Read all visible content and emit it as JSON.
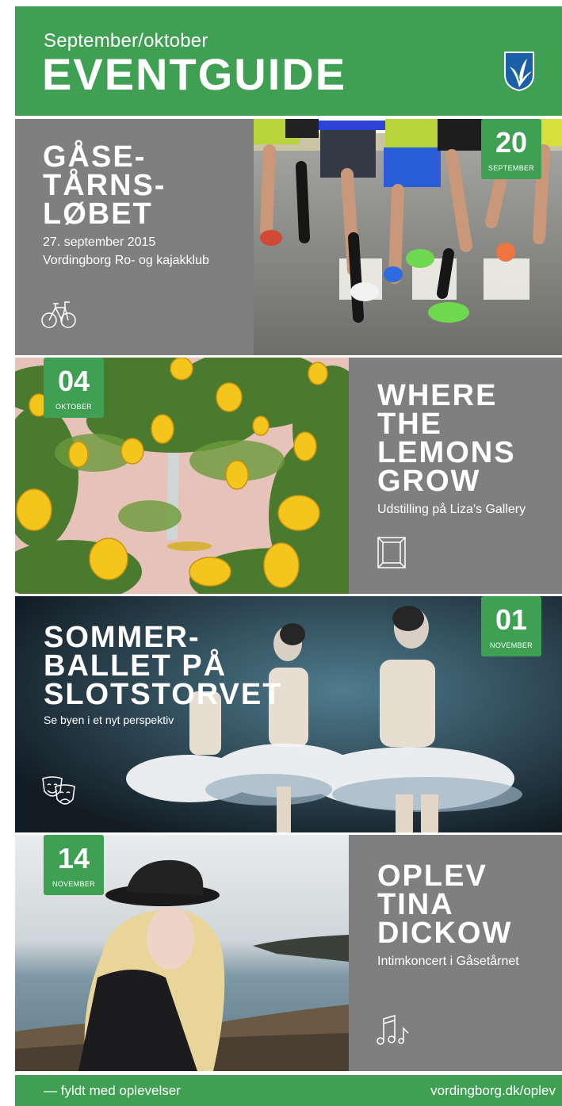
{
  "header": {
    "subtitle": "September/oktober",
    "title": "EVENTGUIDE"
  },
  "events": [
    {
      "title": "GÅSE-\nTÅRNS-\nLØBET",
      "subtitle": "27. september 2015\nVordingborg Ro- og kajakklub",
      "day": "20",
      "month": "SEPTEMBER",
      "icon": "bicycle-icon"
    },
    {
      "title": "WHERE\nTHE\nLEMONS\nGROW",
      "subtitle": "Udstilling på Liza's Gallery",
      "day": "04",
      "month": "OKTOBER",
      "icon": "picture-frame-icon"
    },
    {
      "title": "SOMMER-\nBALLET PÅ\nSLOTSTORVET",
      "subtitle": "Se byen i et nyt perspektiv",
      "day": "01",
      "month": "NOVEMBER",
      "icon": "theater-masks-icon"
    },
    {
      "title": "OPLEV\nTINA\nDICKOW",
      "subtitle": "Intimkoncert i Gåsetårnet",
      "day": "14",
      "month": "NOVEMBER",
      "icon": "music-notes-icon"
    }
  ],
  "footer": {
    "tagline": "— fyldt med oplevelser",
    "url": "vordingborg.dk/oplev"
  },
  "colors": {
    "accent": "#3f9f52",
    "panel": "#7f7f7f"
  }
}
